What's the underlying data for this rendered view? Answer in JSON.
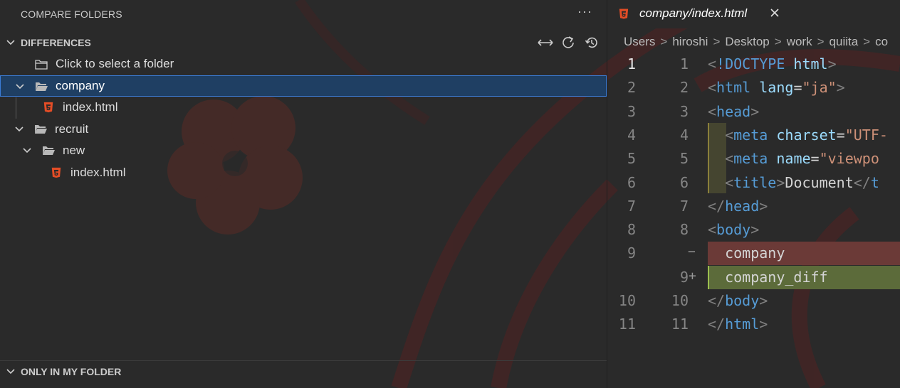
{
  "sidebar": {
    "title": "COMPARE FOLDERS",
    "more_label": "···",
    "differences": {
      "label": "DIFFERENCES",
      "actions": [
        "swap-icon",
        "refresh-icon",
        "history-icon"
      ],
      "select_folder_label": "Click to select a folder",
      "tree": [
        {
          "label": "company",
          "type": "folder",
          "expanded": true,
          "selected": true
        },
        {
          "label": "index.html",
          "type": "html-file"
        },
        {
          "label": "recruit",
          "type": "folder",
          "expanded": true
        },
        {
          "label": "new",
          "type": "folder",
          "expanded": true
        },
        {
          "label": "index.html",
          "type": "html-file"
        }
      ]
    },
    "only_in_my_folder": {
      "label": "ONLY IN MY FOLDER"
    }
  },
  "editor": {
    "tab": {
      "title": "company/index.html"
    },
    "breadcrumb": [
      "Users",
      "hiroshi",
      "Desktop",
      "work",
      "quiita",
      "co"
    ],
    "lines": [
      {
        "left": "1",
        "right": "1",
        "kind": "normal",
        "tokens": [
          [
            "punc",
            "<"
          ],
          [
            "tag",
            "!DOCTYPE"
          ],
          [
            "text",
            " "
          ],
          [
            "attr",
            "html"
          ],
          [
            "punc",
            ">"
          ]
        ]
      },
      {
        "left": "2",
        "right": "2",
        "kind": "normal",
        "tokens": [
          [
            "punc",
            "<"
          ],
          [
            "tag",
            "html"
          ],
          [
            "text",
            " "
          ],
          [
            "attr",
            "lang"
          ],
          [
            "text",
            "="
          ],
          [
            "str",
            "\"ja\""
          ],
          [
            "punc",
            ">"
          ]
        ]
      },
      {
        "left": "3",
        "right": "3",
        "kind": "normal",
        "tokens": [
          [
            "punc",
            "<"
          ],
          [
            "tag",
            "head"
          ],
          [
            "punc",
            ">"
          ]
        ]
      },
      {
        "left": "4",
        "right": "4",
        "kind": "normal",
        "tokens": [
          [
            "text",
            "  "
          ],
          [
            "punc",
            "<"
          ],
          [
            "tag",
            "meta"
          ],
          [
            "text",
            " "
          ],
          [
            "attr",
            "charset"
          ],
          [
            "text",
            "="
          ],
          [
            "str",
            "\"UTF-"
          ]
        ]
      },
      {
        "left": "5",
        "right": "5",
        "kind": "normal",
        "tokens": [
          [
            "text",
            "  "
          ],
          [
            "punc",
            "<"
          ],
          [
            "tag",
            "meta"
          ],
          [
            "text",
            " "
          ],
          [
            "attr",
            "name"
          ],
          [
            "text",
            "="
          ],
          [
            "str",
            "\"viewpo"
          ]
        ]
      },
      {
        "left": "6",
        "right": "6",
        "kind": "normal",
        "tokens": [
          [
            "text",
            "  "
          ],
          [
            "punc",
            "<"
          ],
          [
            "tag",
            "title"
          ],
          [
            "punc",
            ">"
          ],
          [
            "text",
            "Document"
          ],
          [
            "punc",
            "</"
          ],
          [
            "tag",
            "t"
          ]
        ]
      },
      {
        "left": "7",
        "right": "7",
        "kind": "normal",
        "tokens": [
          [
            "punc",
            "</"
          ],
          [
            "tag",
            "head"
          ],
          [
            "punc",
            ">"
          ]
        ]
      },
      {
        "left": "8",
        "right": "8",
        "kind": "normal",
        "tokens": [
          [
            "punc",
            "<"
          ],
          [
            "tag",
            "body"
          ],
          [
            "punc",
            ">"
          ]
        ]
      },
      {
        "left": "9",
        "right": "",
        "sign": "−",
        "kind": "removed",
        "tokens": [
          [
            "text",
            "  company"
          ]
        ]
      },
      {
        "left": "",
        "right": "9",
        "sign": "+",
        "kind": "added",
        "tokens": [
          [
            "text",
            "  company_diff"
          ]
        ]
      },
      {
        "left": "10",
        "right": "10",
        "kind": "normal",
        "tokens": [
          [
            "punc",
            "</"
          ],
          [
            "tag",
            "body"
          ],
          [
            "punc",
            ">"
          ]
        ]
      },
      {
        "left": "11",
        "right": "11",
        "kind": "normal",
        "tokens": [
          [
            "punc",
            "</"
          ],
          [
            "tag",
            "html"
          ],
          [
            "punc",
            ">"
          ]
        ]
      }
    ],
    "active_line": 0
  },
  "colors": {
    "selection_bg": "#1f3f63",
    "selection_border": "#3b7dd8",
    "html_icon": "#e44d26",
    "removed_bg": "#6b3a37",
    "added_bg": "#5c6b3a"
  }
}
